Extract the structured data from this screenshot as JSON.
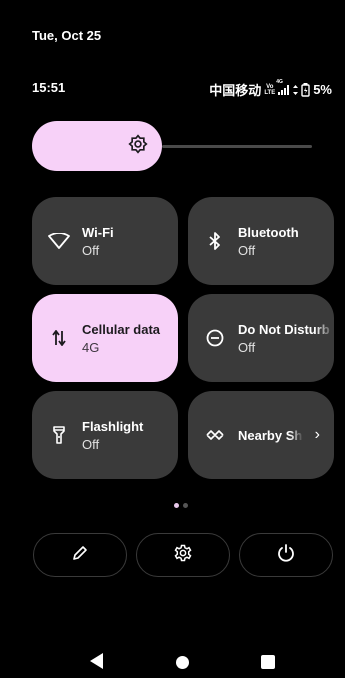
{
  "header": {
    "date": "Tue, Oct 25",
    "time": "15:51",
    "carrier": "中国移动",
    "volte_top": "Vo",
    "volte_bottom": "LTE",
    "network_gen": "4G",
    "battery": "5%"
  },
  "brightness": {
    "level": 0.46
  },
  "tiles": [
    {
      "label": "Wi-Fi",
      "sub": "Off",
      "icon": "wifi-icon",
      "active": false
    },
    {
      "label": "Bluetooth",
      "sub": "Off",
      "icon": "bluetooth-icon",
      "active": false
    },
    {
      "label": "Cellular data",
      "sub": "4G",
      "icon": "data-arrows-icon",
      "active": true
    },
    {
      "label": "Do Not Disturb",
      "sub": "Off",
      "icon": "do-not-disturb-icon",
      "active": false
    },
    {
      "label": "Flashlight",
      "sub": "Off",
      "icon": "flashlight-icon",
      "active": false
    },
    {
      "label": "Nearby Share",
      "sub": "",
      "icon": "nearby-share-icon",
      "active": false
    }
  ],
  "pager": {
    "current": 1,
    "total": 2
  },
  "actions": [
    {
      "icon": "edit-pencil-icon"
    },
    {
      "icon": "settings-gear-icon"
    },
    {
      "icon": "power-icon"
    }
  ],
  "colors": {
    "accent": "#f7d1f8",
    "tile": "#3a3a3a",
    "background": "#000000"
  }
}
